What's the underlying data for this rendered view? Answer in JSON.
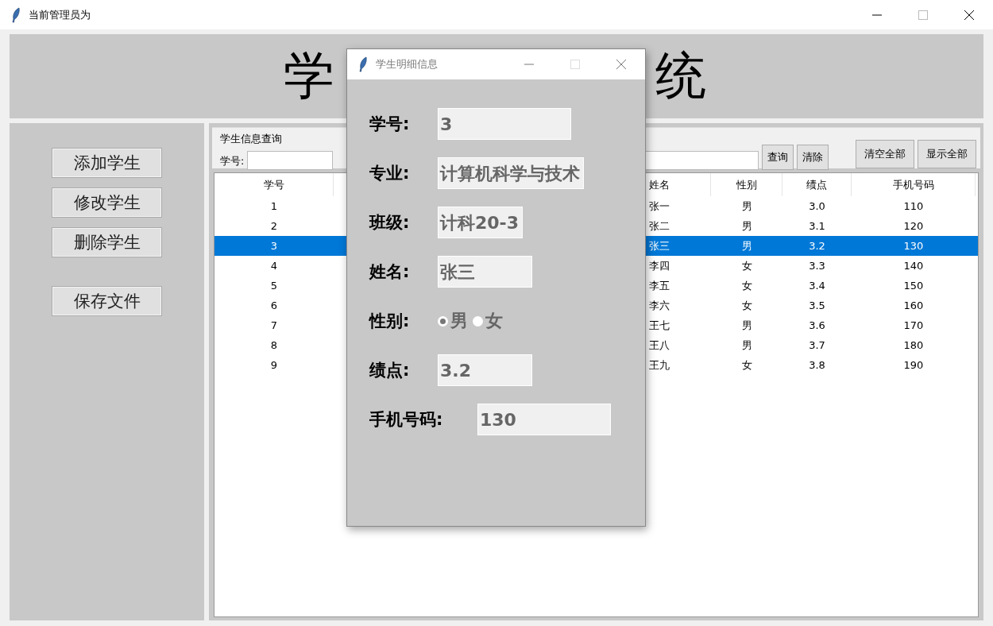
{
  "window": {
    "title": "当前管理员为"
  },
  "header": {
    "title_parts": [
      "学",
      "统"
    ]
  },
  "sidebar": {
    "buttons": [
      {
        "label": "添加学生"
      },
      {
        "label": "修改学生"
      },
      {
        "label": "删除学生"
      },
      {
        "label": "保存文件"
      }
    ]
  },
  "query": {
    "group_title": "学生信息查询",
    "id_label": "学号:",
    "buttons": [
      "查询",
      "清除"
    ],
    "right_buttons": [
      "清空全部",
      "显示全部"
    ]
  },
  "table": {
    "columns": [
      "学号",
      "姓名",
      "性别",
      "绩点",
      "手机号码"
    ],
    "rows": [
      {
        "cells": [
          "1",
          "张一",
          "男",
          "3.0",
          "110"
        ],
        "selected": false
      },
      {
        "cells": [
          "2",
          "张二",
          "男",
          "3.1",
          "120"
        ],
        "selected": false
      },
      {
        "cells": [
          "3",
          "张三",
          "男",
          "3.2",
          "130"
        ],
        "selected": true
      },
      {
        "cells": [
          "4",
          "李四",
          "女",
          "3.3",
          "140"
        ],
        "selected": false
      },
      {
        "cells": [
          "5",
          "李五",
          "女",
          "3.4",
          "150"
        ],
        "selected": false
      },
      {
        "cells": [
          "6",
          "李六",
          "女",
          "3.5",
          "160"
        ],
        "selected": false
      },
      {
        "cells": [
          "7",
          "王七",
          "男",
          "3.6",
          "170"
        ],
        "selected": false
      },
      {
        "cells": [
          "8",
          "王八",
          "男",
          "3.7",
          "180"
        ],
        "selected": false
      },
      {
        "cells": [
          "9",
          "王九",
          "女",
          "3.8",
          "190"
        ],
        "selected": false
      }
    ]
  },
  "dialog": {
    "title": "学生明细信息",
    "fields": [
      {
        "kind": "entry",
        "label": "学号:",
        "value": "3"
      },
      {
        "kind": "entry",
        "label": "专业:",
        "value": "计算机科学与技术"
      },
      {
        "kind": "entry",
        "label": "班级:",
        "value": "计科20-3"
      },
      {
        "kind": "entry",
        "label": "姓名:",
        "value": "张三"
      },
      {
        "kind": "radio",
        "label": "性别:",
        "options": [
          {
            "label": "男",
            "selected": true
          },
          {
            "label": "女",
            "selected": false
          }
        ]
      },
      {
        "kind": "entry",
        "label": "绩点:",
        "value": "3.2"
      },
      {
        "kind": "entry",
        "label": "手机号码:",
        "value": "130"
      }
    ]
  }
}
